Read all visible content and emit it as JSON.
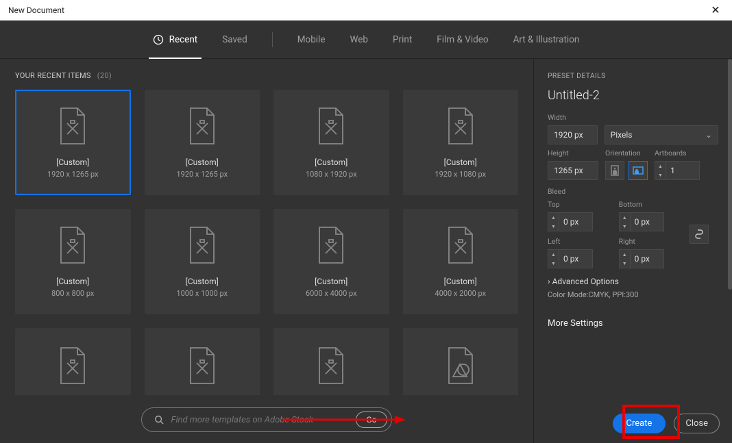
{
  "window": {
    "title": "New Document"
  },
  "tabs": {
    "recent": "Recent",
    "saved": "Saved",
    "mobile": "Mobile",
    "web": "Web",
    "print": "Print",
    "film": "Film & Video",
    "art": "Art & Illustration"
  },
  "recent": {
    "label": "YOUR RECENT ITEMS",
    "count": "(20)",
    "presets": [
      {
        "title": "[Custom]",
        "dims": "1920 x 1265 px"
      },
      {
        "title": "[Custom]",
        "dims": "1920 x 1265 px"
      },
      {
        "title": "[Custom]",
        "dims": "1080 x 1920 px"
      },
      {
        "title": "[Custom]",
        "dims": "1920 x 1080 px"
      },
      {
        "title": "[Custom]",
        "dims": "800 x 800 px"
      },
      {
        "title": "[Custom]",
        "dims": "1000 x 1000 px"
      },
      {
        "title": "[Custom]",
        "dims": "6000 x 4000 px"
      },
      {
        "title": "[Custom]",
        "dims": "4000 x 2000 px"
      }
    ]
  },
  "search": {
    "placeholder": "Find more templates on Adobe Stock",
    "go": "Go"
  },
  "details": {
    "header": "PRESET DETAILS",
    "name": "Untitled-2",
    "width_label": "Width",
    "width": "1920 px",
    "unit": "Pixels",
    "height_label": "Height",
    "height": "1265 px",
    "orientation_label": "Orientation",
    "artboards_label": "Artboards",
    "artboards": "1",
    "bleed_label": "Bleed",
    "top_label": "Top",
    "bottom_label": "Bottom",
    "left_label": "Left",
    "right_label": "Right",
    "bleed_top": "0 px",
    "bleed_bottom": "0 px",
    "bleed_left": "0 px",
    "bleed_right": "0 px",
    "advanced": "Advanced Options",
    "mode": "Color Mode:CMYK, PPI:300",
    "more": "More Settings"
  },
  "buttons": {
    "create": "Create",
    "close": "Close"
  }
}
